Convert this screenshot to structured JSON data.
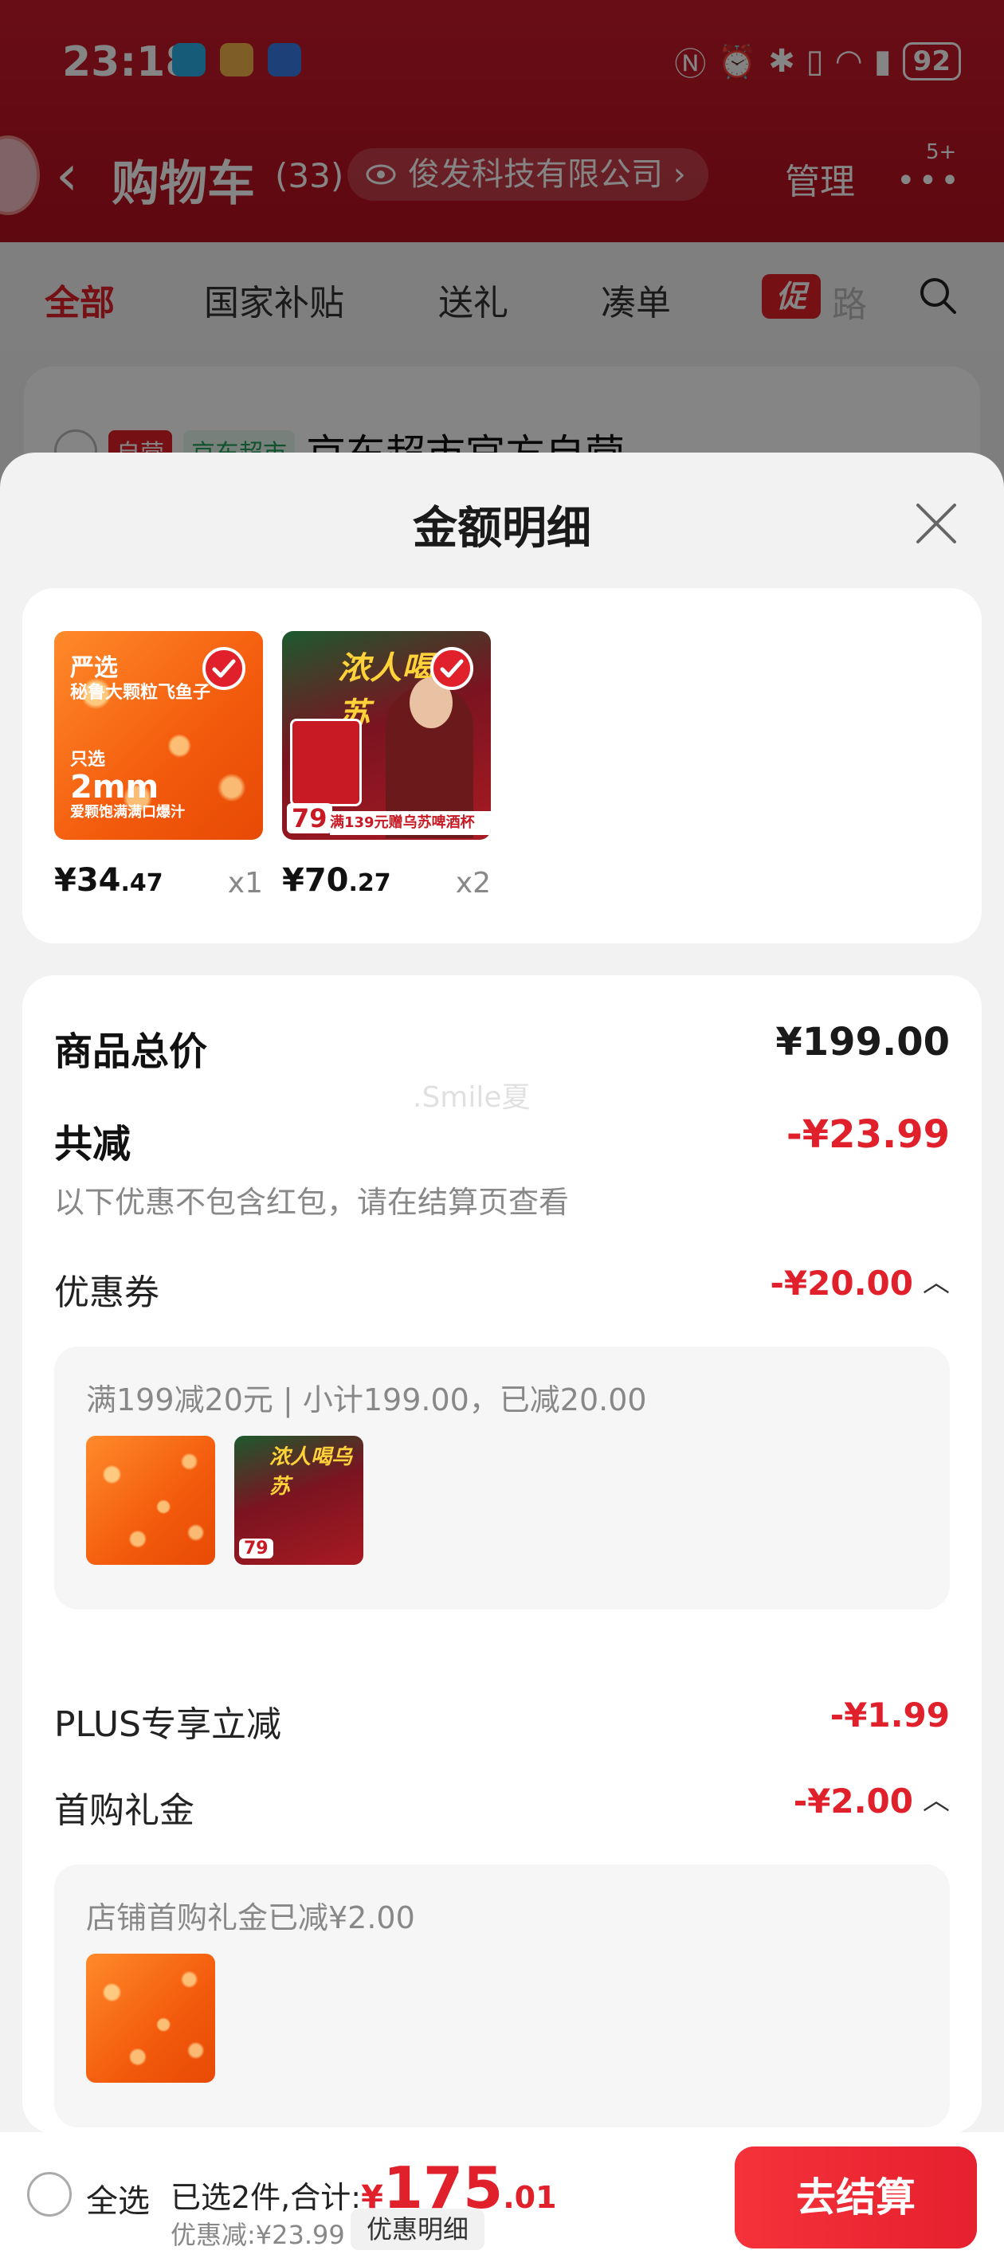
{
  "status": {
    "time": "23:18",
    "battery": "92"
  },
  "cart": {
    "title": "购物车",
    "count": "(33)",
    "company": "俊发科技有限公司",
    "manage": "管理",
    "badge": "5+",
    "tabs": [
      "全部",
      "国家补贴",
      "送礼",
      "凑单"
    ],
    "promo_tab": "促",
    "promo_tail": "路",
    "store_tag_self": "自营",
    "store_tag_market": "京东超市",
    "store_name": "京东超市官方自营"
  },
  "sheet": {
    "title": "金额明细",
    "products": [
      {
        "price_main": "¥34",
        "price_cents": ".47",
        "qty": "x1",
        "img_lines": [
          "严选",
          "秘鲁大颗粒飞鱼子",
          "只选",
          "2mm",
          "爱颗饱满满口爆汁"
        ]
      },
      {
        "price_main": "¥70",
        "price_cents": ".27",
        "qty": "x2",
        "img_headline": "浓人喝乌苏",
        "img_price": "79",
        "img_banner": "满139元赠乌苏啤酒杯"
      }
    ],
    "total_label": "商品总价",
    "total_value": "¥199.00",
    "reduce_label": "共减",
    "reduce_value": "-¥23.99",
    "reduce_note": "以下优惠不包含红包，请在结算页查看",
    "watermark": ".Smile夏",
    "coupon_label": "优惠券",
    "coupon_value": "-¥20.00",
    "coupon_detail": "满199减20元 | 小计199.00，已减20.00",
    "plus_label": "PLUS专享立减",
    "plus_value": "-¥1.99",
    "first_label": "首购礼金",
    "first_value": "-¥2.00",
    "first_detail": "店铺首购礼金已减¥2.00"
  },
  "bottom": {
    "select_all": "全选",
    "summary_prefix": "已选2件,合计:",
    "yen": "¥",
    "total_main": "175",
    "total_cents": ".01",
    "saved": "优惠减:¥23.99",
    "detail_button": "优惠明细",
    "checkout": "去结算"
  },
  "colors": {
    "accent_red": "#e0202a",
    "header_red": "#c81a2a"
  }
}
